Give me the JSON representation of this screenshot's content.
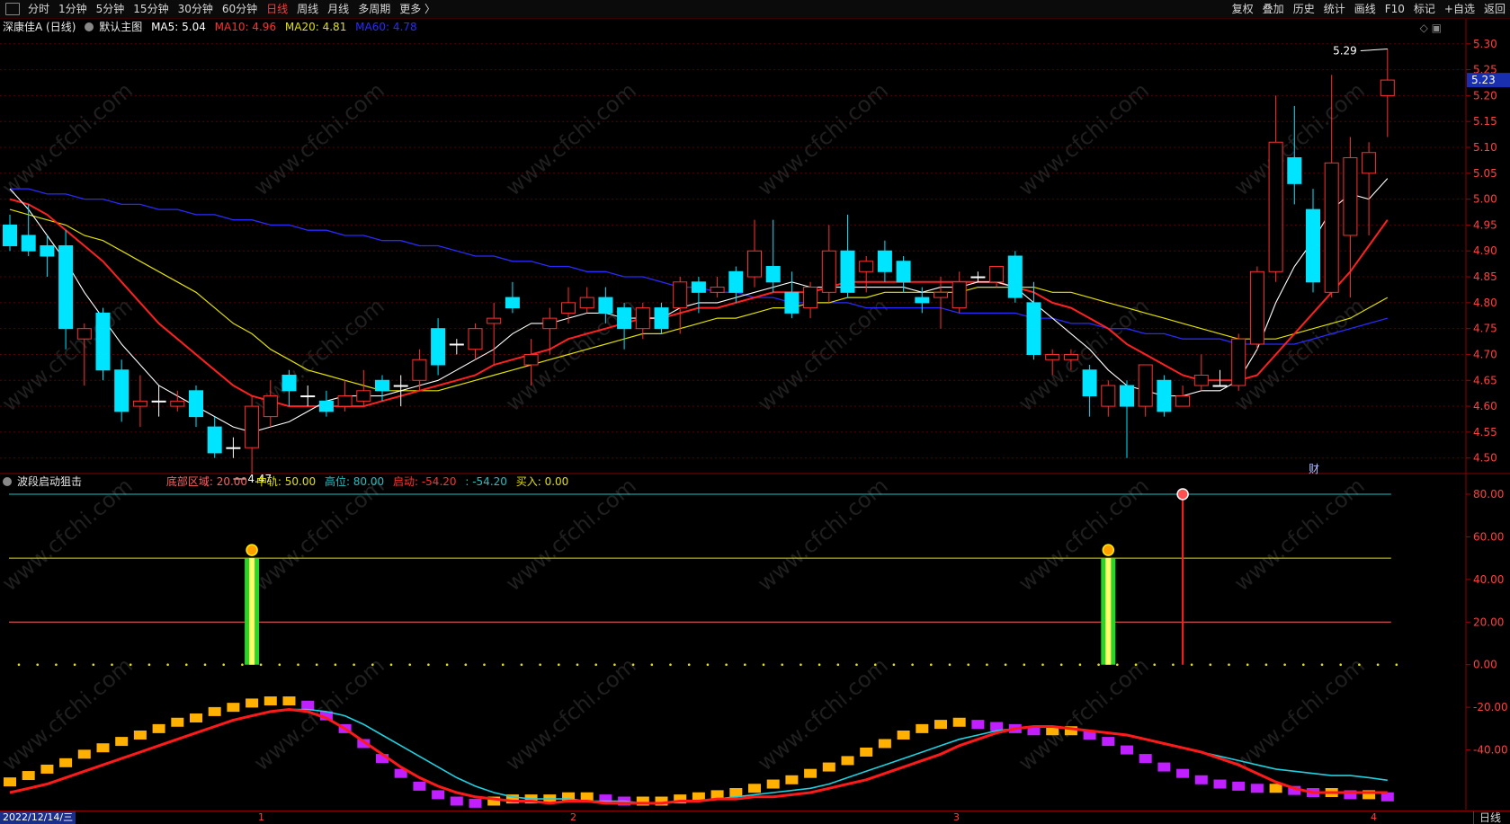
{
  "toolbar": {
    "periods": [
      "分时",
      "1分钟",
      "5分钟",
      "15分钟",
      "30分钟",
      "60分钟",
      "日线",
      "周线",
      "月线",
      "多周期",
      "更多 〉"
    ],
    "active_period": "日线",
    "right": [
      "复权",
      "叠加",
      "历史",
      "统计",
      "画线",
      "F10",
      "标记",
      "+自选",
      "返回"
    ]
  },
  "main_chart": {
    "stock": "深康佳A (日线)",
    "template": "默认主图",
    "ma_labels": [
      {
        "text": "MA5: 5.04",
        "color": "#ffffff"
      },
      {
        "text": "MA10: 4.96",
        "color": "#ff3030"
      },
      {
        "text": "MA20: 4.81",
        "color": "#e0e000"
      },
      {
        "text": "MA60: 4.78",
        "color": "#2a2aff"
      }
    ],
    "y_ticks": [
      "5.30",
      "5.25",
      "5.20",
      "5.15",
      "5.10",
      "5.05",
      "5.00",
      "4.95",
      "4.90",
      "4.85",
      "4.80",
      "4.75",
      "4.70",
      "4.65",
      "4.60",
      "4.55",
      "4.50"
    ],
    "ylim": [
      4.47,
      5.31
    ],
    "current_price": "5.23",
    "high_annotation": "5.29",
    "low_annotation": "4.47",
    "badge": "财"
  },
  "indicator": {
    "name": "波段启动狙击",
    "values": [
      {
        "text": "底部区域: 20.00",
        "color": "#ff6060"
      },
      {
        "text": "中轨: 50.00",
        "color": "#e0e000"
      },
      {
        "text": "高位: 80.00",
        "color": "#20c0c0"
      },
      {
        "text": "启动: -54.20",
        "color": "#ff3030"
      },
      {
        "text": ": -54.20",
        "color": "#20c0c0"
      },
      {
        "text": "买入: 0.00",
        "color": "#e0e000"
      }
    ],
    "y_ticks": [
      "80.00",
      "60.00",
      "40.00",
      "20.00",
      "0.00",
      "-20.00",
      "-40.00"
    ],
    "ylim": [
      -68,
      88
    ]
  },
  "bottom": {
    "date": "2022/12/14/三",
    "month_ticks": [
      "1",
      "2",
      "3",
      "4"
    ],
    "tab": "日线"
  },
  "chart_data": {
    "type": "candlestick",
    "candles": [
      [
        4.95,
        4.91,
        4.97,
        4.9
      ],
      [
        4.93,
        4.9,
        4.99,
        4.89
      ],
      [
        4.91,
        4.89,
        4.93,
        4.85
      ],
      [
        4.91,
        4.75,
        4.94,
        4.71
      ],
      [
        4.73,
        4.75,
        4.76,
        4.64
      ],
      [
        4.78,
        4.67,
        4.79,
        4.65
      ],
      [
        4.67,
        4.59,
        4.69,
        4.57
      ],
      [
        4.6,
        4.61,
        4.66,
        4.56
      ],
      [
        4.61,
        4.61,
        4.64,
        4.58
      ],
      [
        4.6,
        4.61,
        4.63,
        4.59
      ],
      [
        4.63,
        4.58,
        4.64,
        4.56
      ],
      [
        4.56,
        4.51,
        4.58,
        4.5
      ],
      [
        4.52,
        4.52,
        4.54,
        4.5
      ],
      [
        4.52,
        4.6,
        4.62,
        4.47
      ],
      [
        4.58,
        4.62,
        4.65,
        4.56
      ],
      [
        4.66,
        4.63,
        4.67,
        4.6
      ],
      [
        4.62,
        4.62,
        4.64,
        4.6
      ],
      [
        4.61,
        4.59,
        4.63,
        4.58
      ],
      [
        4.6,
        4.62,
        4.65,
        4.59
      ],
      [
        4.61,
        4.63,
        4.67,
        4.6
      ],
      [
        4.65,
        4.63,
        4.66,
        4.61
      ],
      [
        4.64,
        4.64,
        4.66,
        4.6
      ],
      [
        4.65,
        4.69,
        4.71,
        4.63
      ],
      [
        4.75,
        4.68,
        4.77,
        4.66
      ],
      [
        4.72,
        4.72,
        4.73,
        4.7
      ],
      [
        4.71,
        4.75,
        4.76,
        4.69
      ],
      [
        4.76,
        4.77,
        4.8,
        4.68
      ],
      [
        4.81,
        4.79,
        4.84,
        4.78
      ],
      [
        4.68,
        4.7,
        4.73,
        4.64
      ],
      [
        4.75,
        4.77,
        4.79,
        4.7
      ],
      [
        4.78,
        4.8,
        4.83,
        4.76
      ],
      [
        4.79,
        4.81,
        4.83,
        4.78
      ],
      [
        4.81,
        4.78,
        4.83,
        4.76
      ],
      [
        4.79,
        4.75,
        4.8,
        4.71
      ],
      [
        4.75,
        4.79,
        4.8,
        4.73
      ],
      [
        4.79,
        4.75,
        4.8,
        4.74
      ],
      [
        4.79,
        4.84,
        4.85,
        4.74
      ],
      [
        4.84,
        4.82,
        4.85,
        4.78
      ],
      [
        4.82,
        4.83,
        4.85,
        4.81
      ],
      [
        4.86,
        4.82,
        4.87,
        4.8
      ],
      [
        4.85,
        4.9,
        4.96,
        4.83
      ],
      [
        4.87,
        4.84,
        4.96,
        4.82
      ],
      [
        4.82,
        4.78,
        4.86,
        4.77
      ],
      [
        4.79,
        4.83,
        4.84,
        4.77
      ],
      [
        4.82,
        4.9,
        4.95,
        4.8
      ],
      [
        4.9,
        4.82,
        4.97,
        4.81
      ],
      [
        4.86,
        4.88,
        4.89,
        4.82
      ],
      [
        4.9,
        4.86,
        4.92,
        4.84
      ],
      [
        4.88,
        4.84,
        4.89,
        4.82
      ],
      [
        4.81,
        4.8,
        4.83,
        4.78
      ],
      [
        4.81,
        4.82,
        4.85,
        4.75
      ],
      [
        4.79,
        4.84,
        4.86,
        4.78
      ],
      [
        4.85,
        4.85,
        4.86,
        4.84
      ],
      [
        4.84,
        4.87,
        4.87,
        4.83
      ],
      [
        4.89,
        4.81,
        4.9,
        4.8
      ],
      [
        4.8,
        4.7,
        4.84,
        4.69
      ],
      [
        4.69,
        4.7,
        4.71,
        4.66
      ],
      [
        4.69,
        4.7,
        4.71,
        4.67
      ],
      [
        4.67,
        4.62,
        4.68,
        4.58
      ],
      [
        4.6,
        4.64,
        4.65,
        4.58
      ],
      [
        4.64,
        4.6,
        4.65,
        4.5
      ],
      [
        4.6,
        4.68,
        4.68,
        4.58
      ],
      [
        4.65,
        4.59,
        4.66,
        4.58
      ],
      [
        4.6,
        4.62,
        4.64,
        4.6
      ],
      [
        4.64,
        4.66,
        4.7,
        4.63
      ],
      [
        4.64,
        4.64,
        4.67,
        4.64
      ],
      [
        4.64,
        4.73,
        4.74,
        4.63
      ],
      [
        4.72,
        4.86,
        4.87,
        4.71
      ],
      [
        4.86,
        5.11,
        5.2,
        4.84
      ],
      [
        5.08,
        5.03,
        5.18,
        4.99
      ],
      [
        4.98,
        4.84,
        5.02,
        4.82
      ],
      [
        4.82,
        5.07,
        5.24,
        4.81
      ],
      [
        4.93,
        5.08,
        5.12,
        4.81
      ],
      [
        5.05,
        5.09,
        5.11,
        4.93
      ],
      [
        5.2,
        5.23,
        5.29,
        5.12
      ]
    ],
    "ma5": [
      5.02,
      4.98,
      4.93,
      4.88,
      4.82,
      4.77,
      4.72,
      4.68,
      4.64,
      4.62,
      4.6,
      4.58,
      4.56,
      4.55,
      4.56,
      4.57,
      4.59,
      4.61,
      4.62,
      4.62,
      4.62,
      4.63,
      4.64,
      4.65,
      4.67,
      4.69,
      4.71,
      4.74,
      4.76,
      4.76,
      4.77,
      4.78,
      4.78,
      4.77,
      4.77,
      4.77,
      4.79,
      4.8,
      4.8,
      4.81,
      4.82,
      4.83,
      4.84,
      4.83,
      4.83,
      4.83,
      4.83,
      4.83,
      4.83,
      4.82,
      4.83,
      4.83,
      4.84,
      4.84,
      4.83,
      4.8,
      4.77,
      4.74,
      4.71,
      4.67,
      4.64,
      4.63,
      4.62,
      4.62,
      4.63,
      4.63,
      4.65,
      4.71,
      4.8,
      4.87,
      4.92,
      4.98,
      5.01,
      5.0,
      5.04
    ],
    "ma10": [
      5.0,
      4.99,
      4.97,
      4.94,
      4.91,
      4.88,
      4.84,
      4.8,
      4.76,
      4.73,
      4.7,
      4.67,
      4.64,
      4.62,
      4.61,
      4.6,
      4.6,
      4.6,
      4.6,
      4.6,
      4.61,
      4.62,
      4.63,
      4.64,
      4.65,
      4.66,
      4.68,
      4.69,
      4.7,
      4.71,
      4.73,
      4.74,
      4.75,
      4.76,
      4.77,
      4.77,
      4.78,
      4.79,
      4.79,
      4.8,
      4.81,
      4.82,
      4.82,
      4.82,
      4.83,
      4.84,
      4.84,
      4.84,
      4.84,
      4.84,
      4.84,
      4.84,
      4.84,
      4.84,
      4.83,
      4.82,
      4.8,
      4.79,
      4.77,
      4.75,
      4.72,
      4.7,
      4.68,
      4.66,
      4.65,
      4.65,
      4.65,
      4.66,
      4.7,
      4.74,
      4.78,
      4.82,
      4.86,
      4.91,
      4.96
    ],
    "ma20": [
      4.98,
      4.97,
      4.96,
      4.95,
      4.93,
      4.92,
      4.9,
      4.88,
      4.86,
      4.84,
      4.82,
      4.79,
      4.76,
      4.74,
      4.71,
      4.69,
      4.67,
      4.66,
      4.65,
      4.64,
      4.63,
      4.63,
      4.63,
      4.63,
      4.64,
      4.65,
      4.66,
      4.67,
      4.68,
      4.69,
      4.7,
      4.71,
      4.72,
      4.73,
      4.74,
      4.74,
      4.75,
      4.76,
      4.77,
      4.77,
      4.78,
      4.79,
      4.79,
      4.8,
      4.8,
      4.81,
      4.81,
      4.82,
      4.82,
      4.82,
      4.82,
      4.82,
      4.83,
      4.83,
      4.83,
      4.83,
      4.82,
      4.82,
      4.81,
      4.8,
      4.79,
      4.78,
      4.77,
      4.76,
      4.75,
      4.74,
      4.73,
      4.73,
      4.73,
      4.74,
      4.75,
      4.76,
      4.77,
      4.79,
      4.81
    ],
    "ma60": [
      5.02,
      5.02,
      5.01,
      5.01,
      5.0,
      5.0,
      4.99,
      4.99,
      4.98,
      4.98,
      4.97,
      4.97,
      4.96,
      4.96,
      4.95,
      4.95,
      4.94,
      4.94,
      4.93,
      4.93,
      4.92,
      4.92,
      4.91,
      4.91,
      4.9,
      4.89,
      4.89,
      4.88,
      4.88,
      4.87,
      4.87,
      4.86,
      4.86,
      4.85,
      4.85,
      4.84,
      4.83,
      4.83,
      4.82,
      4.82,
      4.81,
      4.81,
      4.8,
      4.8,
      4.8,
      4.8,
      4.79,
      4.79,
      4.79,
      4.79,
      4.79,
      4.78,
      4.78,
      4.78,
      4.78,
      4.77,
      4.77,
      4.76,
      4.76,
      4.75,
      4.75,
      4.74,
      4.74,
      4.73,
      4.73,
      4.73,
      4.72,
      4.72,
      4.72,
      4.72,
      4.73,
      4.74,
      4.75,
      4.76,
      4.77
    ],
    "ind_qidong": [
      -60,
      -58,
      -56,
      -53,
      -50,
      -47,
      -44,
      -41,
      -38,
      -35,
      -32,
      -29,
      -26,
      -24,
      -22,
      -21,
      -22,
      -25,
      -30,
      -36,
      -42,
      -48,
      -53,
      -57,
      -60,
      -62,
      -63,
      -64,
      -64,
      -65,
      -64,
      -64,
      -65,
      -65,
      -65,
      -65,
      -64,
      -64,
      -63,
      -63,
      -62,
      -62,
      -61,
      -60,
      -58,
      -56,
      -54,
      -51,
      -48,
      -45,
      -42,
      -38,
      -35,
      -32,
      -30,
      -29,
      -29,
      -30,
      -31,
      -32,
      -33,
      -35,
      -37,
      -39,
      -41,
      -44,
      -47,
      -51,
      -55,
      -58,
      -60,
      -60,
      -60,
      -60,
      -60
    ],
    "ind_cyan": [
      -60,
      -58,
      -56,
      -53,
      -50,
      -47,
      -44,
      -41,
      -38,
      -35,
      -32,
      -29,
      -26,
      -24,
      -22,
      -21,
      -21,
      -22,
      -24,
      -28,
      -33,
      -38,
      -43,
      -48,
      -53,
      -57,
      -60,
      -62,
      -63,
      -63,
      -63,
      -64,
      -64,
      -64,
      -65,
      -65,
      -64,
      -64,
      -63,
      -62,
      -61,
      -60,
      -59,
      -58,
      -56,
      -53,
      -50,
      -47,
      -44,
      -41,
      -38,
      -35,
      -33,
      -31,
      -30,
      -29,
      -29,
      -30,
      -31,
      -32,
      -33,
      -35,
      -37,
      -39,
      -41,
      -43,
      -45,
      -47,
      -49,
      -50,
      -51,
      -52,
      -52,
      -53,
      -54.2
    ],
    "ind_bars": [
      -55,
      -52,
      -49,
      -46,
      -42,
      -39,
      -36,
      -33,
      -30,
      -27,
      -25,
      -22,
      -20,
      -18,
      -17,
      -17,
      -19,
      -24,
      -30,
      -37,
      -44,
      -51,
      -57,
      -61,
      -64,
      -65,
      -64,
      -63,
      -63,
      -63,
      -62,
      -62,
      -63,
      -64,
      -64,
      -64,
      -63,
      -62,
      -61,
      -60,
      -58,
      -56,
      -54,
      -51,
      -48,
      -45,
      -41,
      -37,
      -33,
      -30,
      -28,
      -27,
      -28,
      -29,
      -30,
      -31,
      -31,
      -31,
      -33,
      -36,
      -40,
      -44,
      -48,
      -51,
      -54,
      -56,
      -57,
      -58,
      -58,
      -59,
      -60,
      -60,
      -61,
      -61,
      -62
    ],
    "signals_mid": [
      13,
      59
    ],
    "signal_high": 63
  }
}
